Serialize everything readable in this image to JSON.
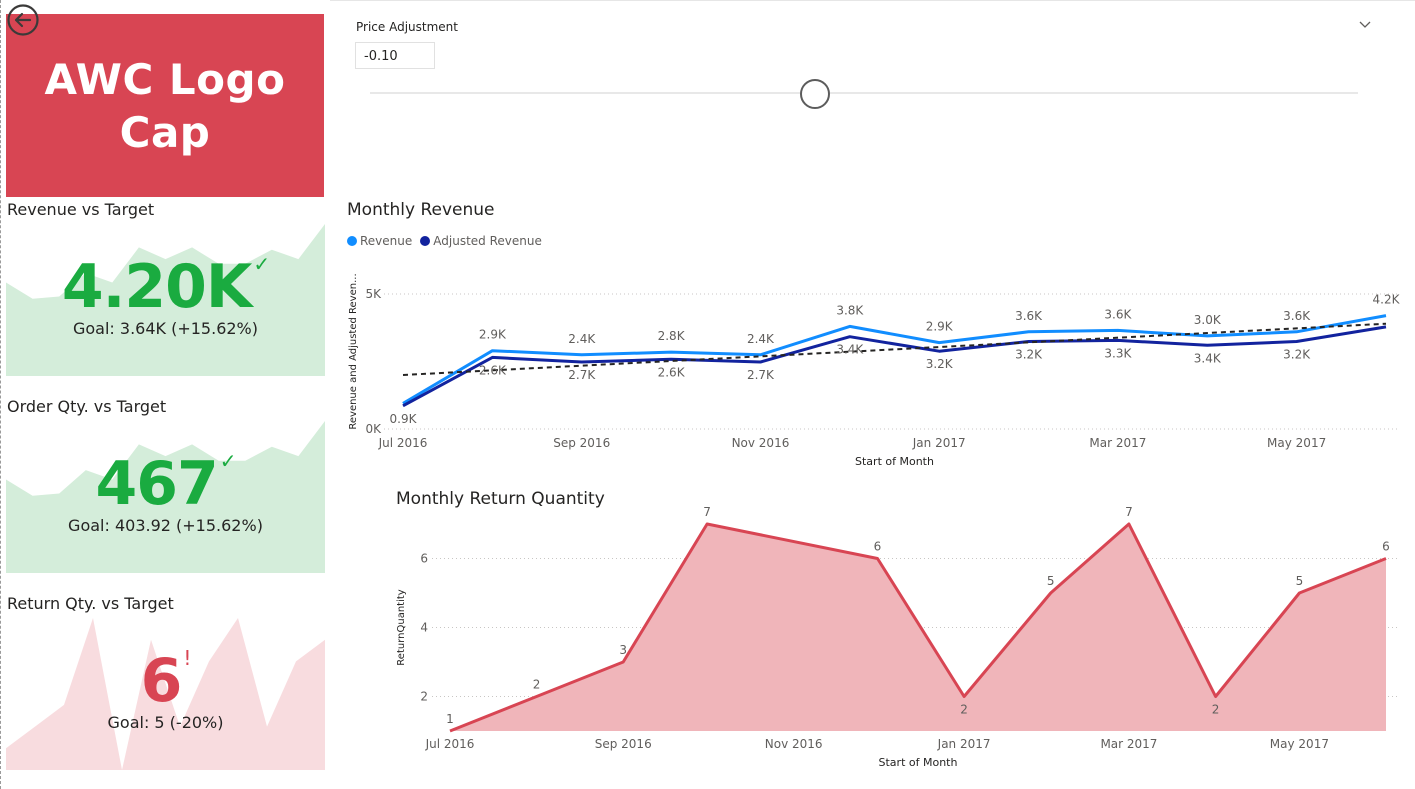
{
  "logo": {
    "text": "AWC Logo Cap",
    "color": "#d84553"
  },
  "slicer": {
    "title": "Price Adjustment",
    "value": "-0.10",
    "position": 0.45
  },
  "kpis": [
    {
      "title": "Revenue vs Target",
      "value": "4.20K",
      "mark": "✓",
      "goal": "Goal: 3.64K (+15.62%)",
      "status_color": "#1aab40",
      "trend_color": "#d4edda",
      "trend": [
        40,
        33,
        34,
        44,
        40,
        55,
        50,
        55,
        48,
        48,
        54,
        50,
        65
      ]
    },
    {
      "title": "Order Qty. vs Target",
      "value": "467",
      "mark": "✓",
      "goal": "Goal: 403.92 (+15.62%)",
      "status_color": "#1aab40",
      "trend_color": "#d4edda",
      "trend": [
        40,
        33,
        34,
        44,
        40,
        55,
        50,
        55,
        48,
        48,
        54,
        50,
        65
      ]
    },
    {
      "title": "Return Qty. vs Target",
      "value": "6",
      "mark": "!",
      "goal": "Goal: 5 (-20%)",
      "status_color": "#d84553",
      "trend_color": "#f8dcdf",
      "trend": [
        1,
        2,
        3,
        7,
        0,
        6,
        2,
        5,
        7,
        2,
        5,
        6
      ]
    }
  ],
  "chart_data": [
    {
      "type": "line",
      "title": "Monthly Revenue",
      "xlabel": "Start of Month",
      "ylabel": "Revenue and Adjusted Reven...",
      "x": [
        "Jul 2016",
        "Aug 2016",
        "Sep 2016",
        "Oct 2016",
        "Nov 2016",
        "Dec 2016",
        "Jan 2017",
        "Feb 2017",
        "Mar 2017",
        "Apr 2017",
        "May 2017",
        "Jun 2017"
      ],
      "x_tick_labels": [
        "Jul 2016",
        "Sep 2016",
        "Nov 2016",
        "Jan 2017",
        "Mar 2017",
        "May 2017"
      ],
      "y_ticks": [
        0,
        5000
      ],
      "y_tick_labels": [
        "0K",
        "5K"
      ],
      "ylim": [
        0,
        5000
      ],
      "grid": true,
      "legend": "top-left",
      "series": [
        {
          "name": "Revenue",
          "color": "#118dff",
          "values": [
            950,
            2900,
            2750,
            2850,
            2750,
            3800,
            3200,
            3600,
            3650,
            3450,
            3600,
            4200
          ],
          "labels": [
            "",
            "2.9K",
            "2.4K",
            "2.8K",
            "2.4K",
            "3.8K",
            "2.9K",
            "3.6K",
            "3.6K",
            "3.0K",
            "3.6K",
            "4.2K"
          ]
        },
        {
          "name": "Adjusted Revenue",
          "color": "#12239e",
          "values": [
            860,
            2650,
            2480,
            2580,
            2480,
            3420,
            2880,
            3240,
            3280,
            3100,
            3240,
            3780
          ],
          "labels": [
            "0.9K",
            "2.6K",
            "2.7K",
            "2.6K",
            "2.7K",
            "3.4K",
            "3.2K",
            "3.2K",
            "3.3K",
            "3.4K",
            "3.2K",
            ""
          ]
        }
      ],
      "trend_line": {
        "start": 2000,
        "end": 3900,
        "style": "dashed",
        "color": "#252423"
      }
    },
    {
      "type": "area",
      "title": "Monthly Return Quantity",
      "xlabel": "Start of Month",
      "ylabel": "ReturnQuantity",
      "x": [
        "Jul 2016",
        "Aug 2016",
        "Sep 2016",
        "Oct 2016",
        "Dec 2016",
        "Jan 2017",
        "Feb 2017",
        "Mar 2017",
        "Apr 2017",
        "May 2017",
        "Jun 2017"
      ],
      "x_dates": [
        "2016-07-01",
        "2016-08-01",
        "2016-09-01",
        "2016-10-01",
        "2016-12-01",
        "2017-01-01",
        "2017-02-01",
        "2017-03-01",
        "2017-04-01",
        "2017-05-01",
        "2017-06-01"
      ],
      "x_tick_labels": [
        "Jul 2016",
        "Sep 2016",
        "Nov 2016",
        "Jan 2017",
        "Mar 2017",
        "May 2017"
      ],
      "values": [
        1,
        2,
        3,
        7,
        6,
        2,
        5,
        7,
        2,
        5,
        6
      ],
      "y_ticks": [
        2,
        4,
        6
      ],
      "ylim": [
        1,
        7
      ],
      "grid": true,
      "line_color": "#d84553",
      "fill_color": "#f0b5ba"
    }
  ]
}
